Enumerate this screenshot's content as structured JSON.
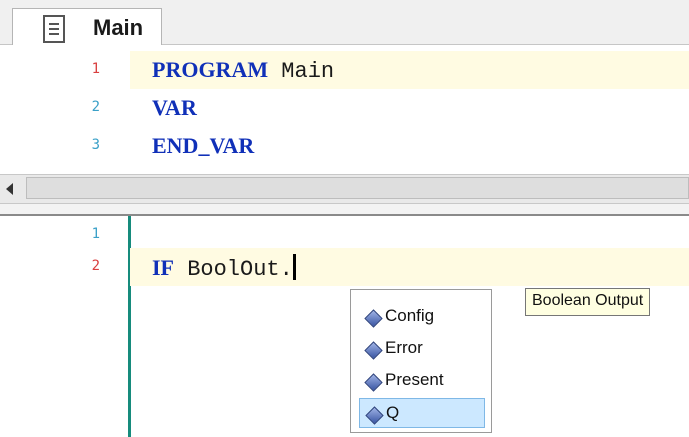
{
  "tab": {
    "label": "Main",
    "icon": "document-icon"
  },
  "declaration": {
    "lines": [
      {
        "num": "1",
        "keyword": "PROGRAM",
        "rest": " Main",
        "modified": true,
        "highlight": true
      },
      {
        "num": "2",
        "keyword": "VAR",
        "rest": "",
        "modified": false,
        "highlight": false
      },
      {
        "num": "3",
        "keyword": "END_VAR",
        "rest": "",
        "modified": false,
        "highlight": false
      }
    ]
  },
  "implementation": {
    "lines": [
      {
        "num": "1",
        "modified": false
      },
      {
        "num": "2",
        "keyword": "IF",
        "rest": " BoolOut.",
        "modified": true
      }
    ]
  },
  "autocomplete": {
    "items": [
      {
        "label": "Config",
        "icon": "property-icon"
      },
      {
        "label": "Error",
        "icon": "property-icon"
      },
      {
        "label": "Present",
        "icon": "property-icon"
      },
      {
        "label": "Q",
        "icon": "property-icon",
        "selected": true
      }
    ],
    "tooltip": "Boolean Output"
  },
  "colors": {
    "keyword": "#1030b8",
    "line_modified": "#d94040",
    "line_normal": "#3aa0c8",
    "gutter_bar": "#168b7c",
    "highlight_bg": "#fffbe2"
  }
}
